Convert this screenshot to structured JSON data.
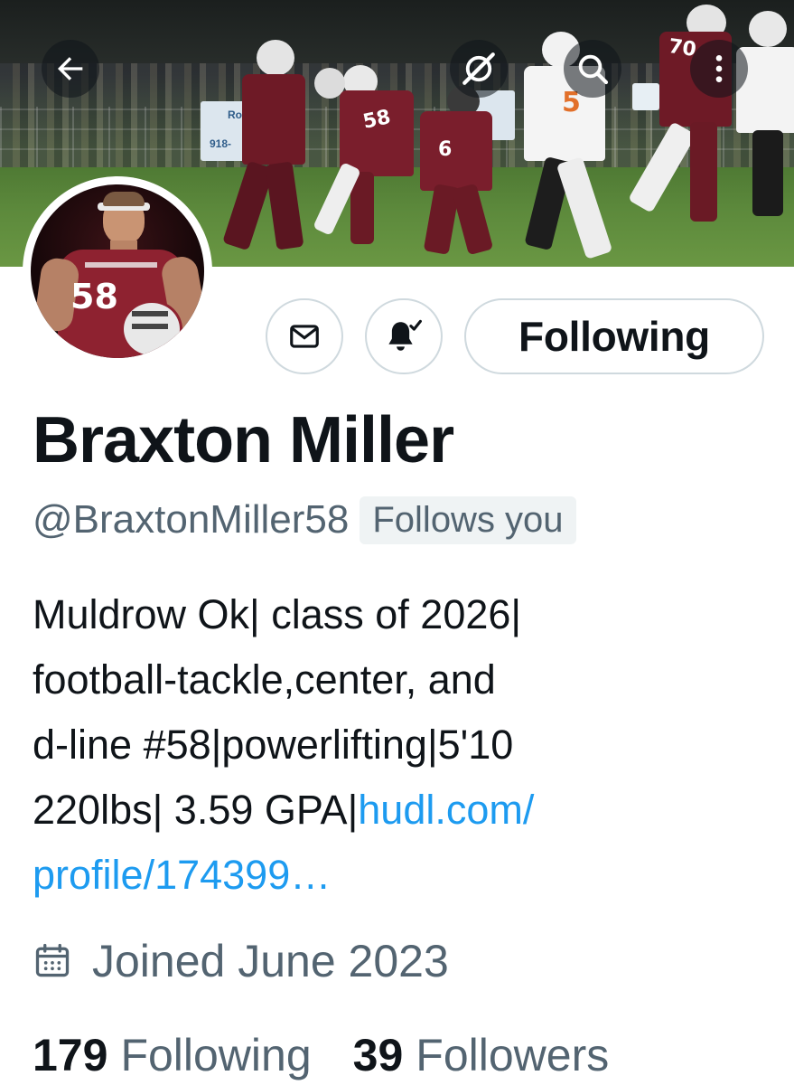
{
  "header": {
    "back_icon": "arrow-left-icon",
    "grok_icon": "grok-icon",
    "search_icon": "search-icon",
    "more_icon": "more-vertical-icon"
  },
  "banner": {
    "sign_text_1": "Ro",
    "sign_text_2": "918-",
    "jersey_numbers": [
      "58",
      "6",
      "70",
      "5"
    ]
  },
  "avatar": {
    "jersey_text": "58"
  },
  "actions": {
    "message_icon": "envelope-icon",
    "notify_icon": "bell-check-icon",
    "following_label": "Following"
  },
  "profile": {
    "name": "Braxton Miller",
    "handle": "@BraxtonMiller58",
    "follows_you": "Follows you",
    "bio_lines": [
      "Muldrow Ok| class of 2026|",
      "football-tackle,center, and",
      "d-line #58|powerlifting|5'10",
      "220lbs| 3.59 GPA|"
    ],
    "bio_link_part1": "hudl.com/",
    "bio_link_part2": "profile/174399…",
    "joined": "Joined June 2023",
    "calendar_icon": "calendar-icon"
  },
  "stats": {
    "following_count": "179",
    "following_label": "Following",
    "followers_count": "39",
    "followers_label": "Followers"
  },
  "colors": {
    "link": "#1d9bf0",
    "secondary_text": "#536471",
    "jersey_maroon": "#7a1e2c"
  }
}
